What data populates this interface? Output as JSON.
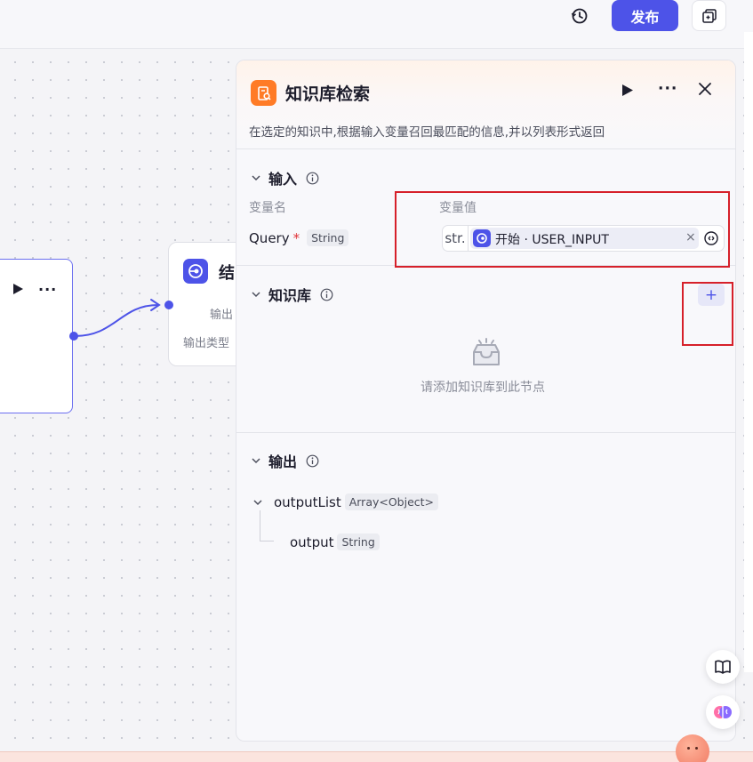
{
  "toolbar": {
    "history_icon": "history-icon",
    "publish_label": "发布",
    "copy_icon": "copy-icon"
  },
  "canvas": {
    "left_node": {
      "run_icon": "play-icon",
      "more_icon": "more-icon",
      "more_label": "···"
    },
    "end_node": {
      "title": "结",
      "output_label": "输出",
      "output_type_label": "输出类型"
    }
  },
  "panel": {
    "title": "知识库检索",
    "description": "在选定的知识中,根据输入变量召回最匹配的信息,并以列表形式返回",
    "more_label": "···",
    "input_section": {
      "title": "输入",
      "col_name": "变量名",
      "col_value": "变量值",
      "rows": [
        {
          "name": "Query",
          "required": "*",
          "type": "String",
          "value_prefix": "str.",
          "value": "开始 · USER_INPUT",
          "clear": "×"
        }
      ]
    },
    "kb_section": {
      "title": "知识库",
      "add_label": "+",
      "empty_text": "请添加知识库到此节点"
    },
    "output_section": {
      "title": "输出",
      "items": [
        {
          "name": "outputList",
          "type": "Array<Object>"
        },
        {
          "name": "output",
          "type": "String"
        }
      ]
    }
  },
  "colors": {
    "accent": "#4d53e8",
    "panel_icon": "#ff7b26",
    "highlight_box": "#d6202a"
  }
}
